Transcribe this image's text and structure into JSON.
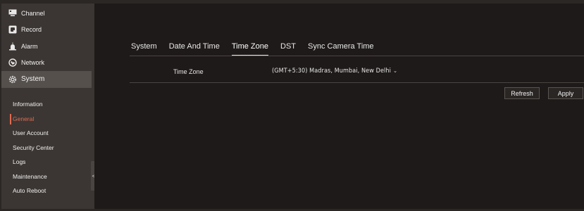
{
  "sidebar": {
    "menu": [
      {
        "label": "Channel",
        "icon": "monitor-icon"
      },
      {
        "label": "Record",
        "icon": "record-icon"
      },
      {
        "label": "Alarm",
        "icon": "alarm-icon"
      },
      {
        "label": "Network",
        "icon": "network-icon"
      },
      {
        "label": "System",
        "icon": "gear-icon",
        "active": true
      }
    ],
    "submenu": [
      {
        "label": "Information"
      },
      {
        "label": "General",
        "active": true
      },
      {
        "label": "User Account"
      },
      {
        "label": "Security Center"
      },
      {
        "label": "Logs"
      },
      {
        "label": "Maintenance"
      },
      {
        "label": "Auto Reboot"
      }
    ],
    "collapse_glyph": "<"
  },
  "tabs": [
    {
      "label": "System"
    },
    {
      "label": "Date And Time"
    },
    {
      "label": "Time Zone",
      "active": true
    },
    {
      "label": "DST"
    },
    {
      "label": "Sync Camera Time"
    }
  ],
  "timezone": {
    "label": "Time Zone",
    "value": "(GMT+5:30) Madras, Mumbai, New Delhi",
    "chevron": "⌄"
  },
  "buttons": {
    "refresh": "Refresh",
    "apply": "Apply"
  },
  "colors": {
    "accent": "#e06a52",
    "sidebar_bg": "#3b3633",
    "content_bg": "#1e1a19"
  }
}
